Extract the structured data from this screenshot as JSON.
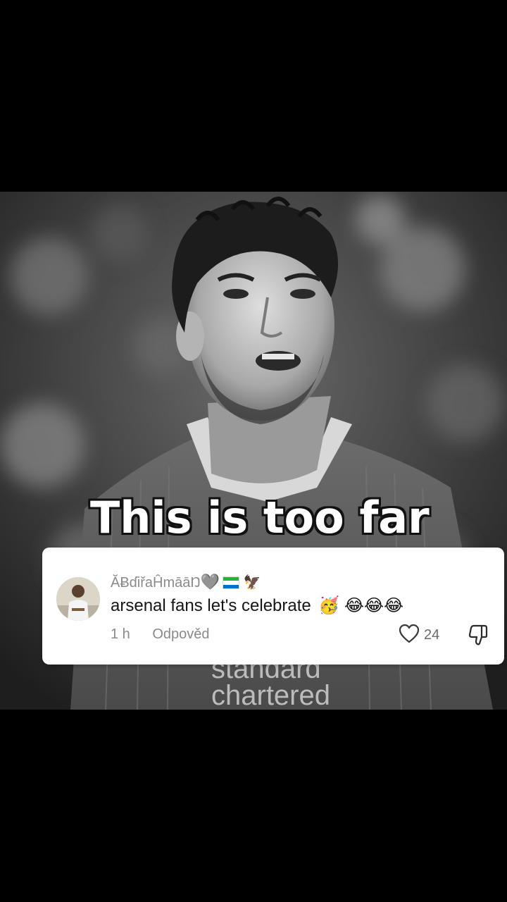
{
  "video": {
    "caption": "This is too far",
    "sponsor_text": "standard chartered"
  },
  "comment": {
    "username": "ĂɃɗiřaĤmāāŊ",
    "username_heart": "🩶",
    "username_extra": "🦅",
    "text": "arsenal fans let's celebrate",
    "emojis": "🥳 😂😂😂",
    "time": "1 h",
    "reply_label": "Odpověd",
    "like_count": "24"
  },
  "icons": {
    "like": "heart-outline-icon",
    "dislike": "thumbs-down-icon",
    "flag": "sierra-leone-flag-icon"
  },
  "colors": {
    "background": "#000000",
    "card": "#ffffff",
    "muted_text": "#8a8a8a",
    "flag_green": "#1eb53a",
    "flag_blue": "#0072c6"
  }
}
